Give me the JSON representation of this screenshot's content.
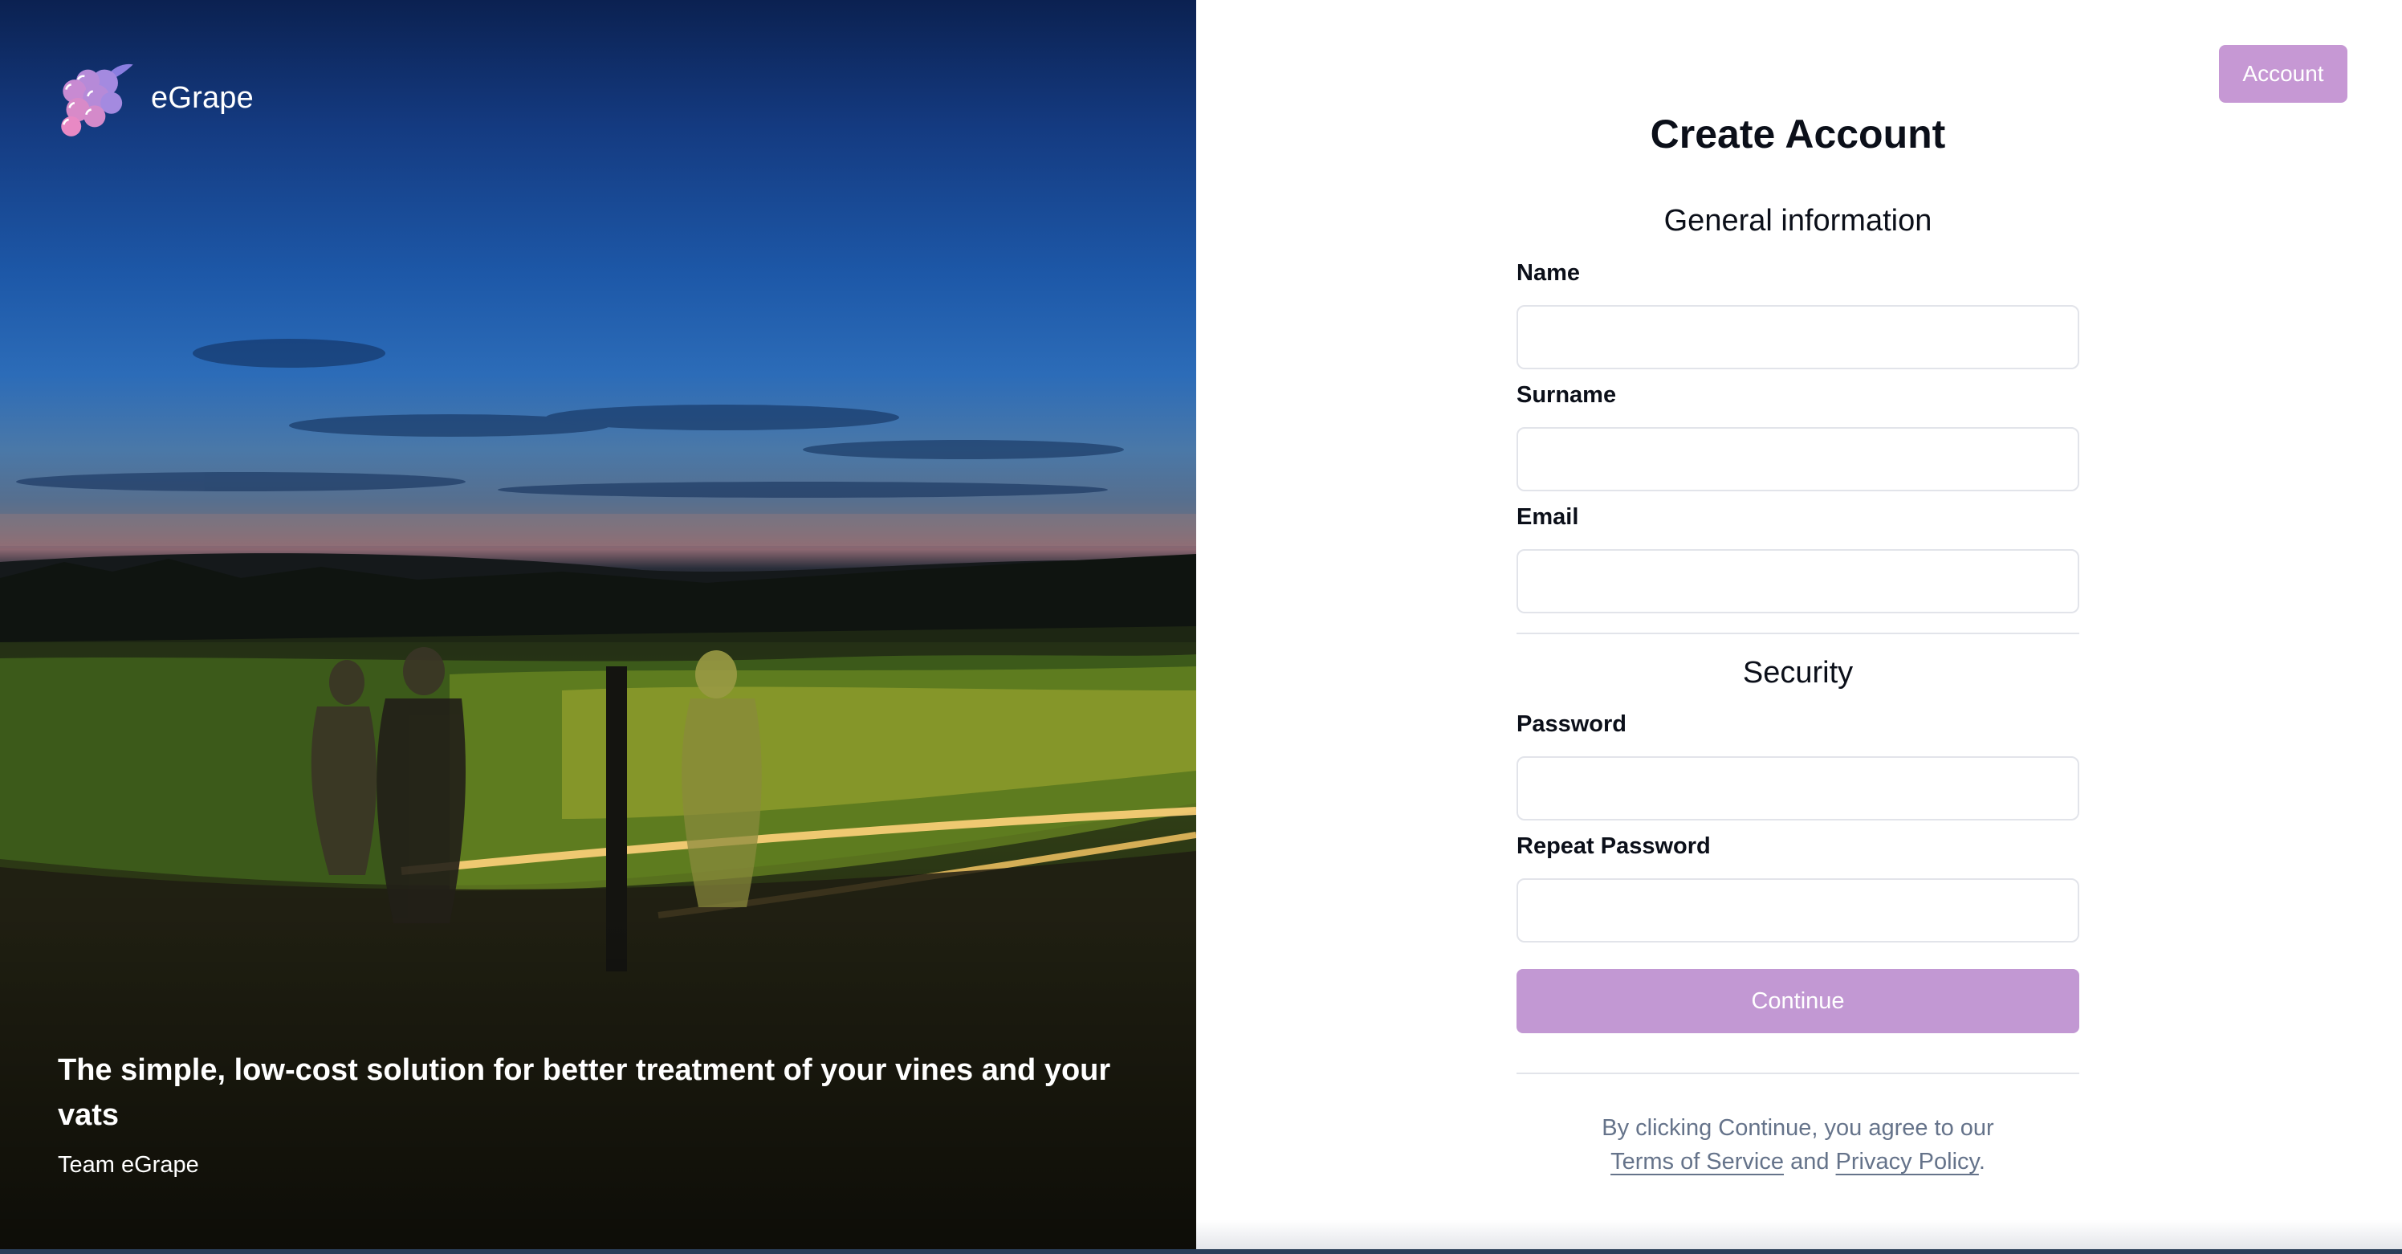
{
  "brand": {
    "name": "eGrape",
    "logo_icon": "grape-bunch-icon",
    "logo_colors": [
      "#e889c4",
      "#b48ad9",
      "#8a7ee0"
    ]
  },
  "hero": {
    "image_description_icon": "vineyard-night-photo",
    "quote": "The simple, low-cost solution for better treatment of your vines and your vats",
    "author": "Team eGrape"
  },
  "header": {
    "account_button": "Account"
  },
  "form": {
    "title": "Create Account",
    "general_section": "General information",
    "name_label": "Name",
    "name_value": "",
    "surname_label": "Surname",
    "surname_value": "",
    "email_label": "Email",
    "email_value": "",
    "security_section": "Security",
    "password_label": "Password",
    "password_value": "",
    "repeat_password_label": "Repeat Password",
    "repeat_password_value": "",
    "continue_button": "Continue"
  },
  "legal": {
    "prefix": "By clicking Continue, you agree to our",
    "terms_link": "Terms of Service",
    "conjunction": "and",
    "privacy_link": "Privacy Policy",
    "suffix": "."
  },
  "colors": {
    "accent": "#c298d3",
    "muted_text": "#65738a",
    "border": "#e2e4ea"
  }
}
